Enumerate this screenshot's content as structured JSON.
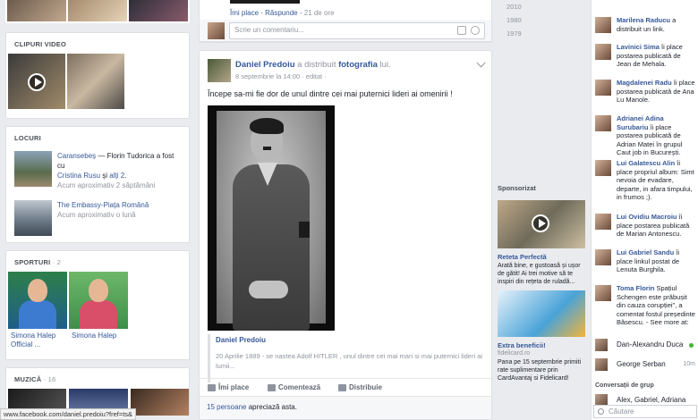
{
  "left": {
    "videos": {
      "title": "Clipuri video"
    },
    "places": {
      "title": "Locuri",
      "items": [
        {
          "place": "Caransebeș",
          "line1_rest": " — Florin Tudorica a fost cu",
          "with1": "Cristina Rusu",
          "and": " și ",
          "others": "alți 2",
          "time": "Acum aproximativ 2 săptămâni"
        },
        {
          "place": "The Embassy-Piața Română",
          "time": "Acum aproximativ o lună"
        }
      ]
    },
    "sports": {
      "title": "Sporturi",
      "count": "· 2",
      "items": [
        "Simona Halep Official ...",
        "Simona Halep"
      ]
    },
    "music": {
      "title": "Muzică",
      "count": "· 16"
    },
    "statusbar": "www.facebook.com/daniel.predoiu?fref=ts&"
  },
  "feed": {
    "prev_actions": {
      "like": "Îmi place",
      "reply": "Răspunde",
      "time": "21 de ore"
    },
    "comment_placeholder": "Scrie un comentariu...",
    "post": {
      "author": "Daniel Predoiu",
      "action": " a distribuit ",
      "object": "fotografia",
      "object_owner": " lui.",
      "date": "8 septembrie la 14:00 · editat ·",
      "text": "Începe sa-mi fie dor de unul dintre cei mai puternici lideri ai omenirii !",
      "quote_author": "Daniel Predoiu",
      "quote_text": "20 Aprilie 1889 - se nastea Adolf HITLER , unul dintre cei mai mari si mai puternici lideri ai lumii...",
      "actions": {
        "like": "Îmi place",
        "comment": "Comentează",
        "share": "Distribuie"
      },
      "likes_count": "15 persoane",
      "likes_rest": " apreciază asta."
    }
  },
  "years": [
    "2010",
    "1980",
    "1979"
  ],
  "sponsored": {
    "title": "Sponsorizat",
    "ads": [
      {
        "title": "Reteta Perfectă",
        "desc": "Arată bine, e gustoasă și ușor de gătit! Ai trei motive să te inspiri din rețeta de ruladă..."
      },
      {
        "title": "Extra beneficii!",
        "url": "fidelicard.ro",
        "desc": "Pana pe 15 septembrie primiti rate suplimentare prin CardAvantaj si Fidelicard!"
      }
    ]
  },
  "ticker": {
    "items": [
      {
        "name": "Marilena Raducu",
        "text": " a distribuit un link."
      },
      {
        "name": "Lavinici Sima",
        "text": " îi place postarea publicată de Jean de Mehala."
      },
      {
        "name": "Magdalenei Radu",
        "text": " îi place postarea publicată de Ana Lu Manole."
      },
      {
        "name": "Adrianei Adina Surubariu",
        "text": " îi place postarea publicată de Adrian Matei în grupul Caut job in București."
      },
      {
        "name": "Lui Galatescu Alin",
        "text": " îi place propriul album: Simt nevoia de evadare, departe, in afara timpului, in frumos ;)."
      },
      {
        "name": "Lui Ovidiu Macroiu",
        "text": " îi place postarea publicată de Marian Antonescu."
      },
      {
        "name": "Lui Gabriel Sandu",
        "text": " îi place linkul postat de Lenuta Burghila."
      },
      {
        "name": "Toma Florin",
        "text": " Spațiul Schengen este prăbușit din cauza corupției\", a comentat fostul președinte Băsescu. - See more at:"
      }
    ],
    "chat": [
      {
        "name": "Dan-Alexandru Duca",
        "time": ""
      },
      {
        "name": "George Serban",
        "time": "10m"
      }
    ],
    "group_header": "Conversații de grup",
    "group_first": "Alex, Gabriel, Adriana",
    "search_placeholder": "Căutare"
  }
}
